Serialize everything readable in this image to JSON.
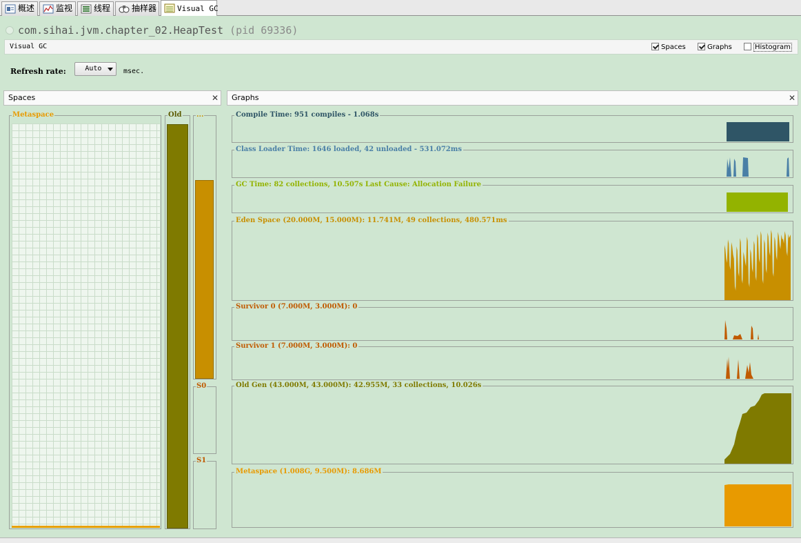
{
  "tabs": [
    {
      "label": "概述",
      "icon": "overview-icon"
    },
    {
      "label": "监视",
      "icon": "monitor-icon"
    },
    {
      "label": "线程",
      "icon": "threads-icon"
    },
    {
      "label": "抽样器",
      "icon": "sampler-icon"
    },
    {
      "label": "Visual GC",
      "icon": "visualgc-icon",
      "active": true
    }
  ],
  "app": {
    "title": "com.sihai.jvm.chapter_02.HeapTest",
    "pid": "(pid 69336)"
  },
  "visualgc": {
    "title": "Visual GC",
    "options": {
      "spaces": {
        "label": "Spaces",
        "checked": true
      },
      "graphs": {
        "label": "Graphs",
        "checked": true
      },
      "histogram": {
        "label": "Histogram",
        "checked": false
      }
    },
    "refresh": {
      "label": "Refresh rate:",
      "value": "Auto",
      "unit": "msec."
    }
  },
  "spaces_panel": {
    "title": "Spaces",
    "metaspace_label": "Metaspace",
    "old_label": "Old",
    "eden_label": "...",
    "s0_label": "S0",
    "s1_label": "S1",
    "old_fill": 1.0,
    "eden_fill": 0.78
  },
  "graphs_panel": {
    "title": "Graphs",
    "compile": "Compile Time: 951 compiles - 1.068s",
    "classloader": "Class Loader Time: 1646 loaded, 42 unloaded - 531.072ms",
    "gc": "GC Time: 82 collections, 10.507s  Last Cause: Allocation Failure",
    "eden": "Eden Space (20.000M, 15.000M): 11.741M, 49 collections, 480.571ms",
    "survivor0": "Survivor 0 (7.000M, 3.000M): 0",
    "survivor1": "Survivor 1 (7.000M, 3.000M): 0",
    "oldgen": "Old Gen (43.000M, 43.000M): 42.955M, 33 collections, 10.026s",
    "metaspace": "Metaspace (1.008G, 9.500M): 8.686M"
  },
  "colors": {
    "compile": "#2f5566",
    "classloader": "#4a7fa6",
    "gc": "#93b300",
    "eden": "#c88f00",
    "survivor": "#c05a00",
    "oldgen": "#7f7a00",
    "metaspace": "#e89a00",
    "background": "#cfe6d1"
  }
}
